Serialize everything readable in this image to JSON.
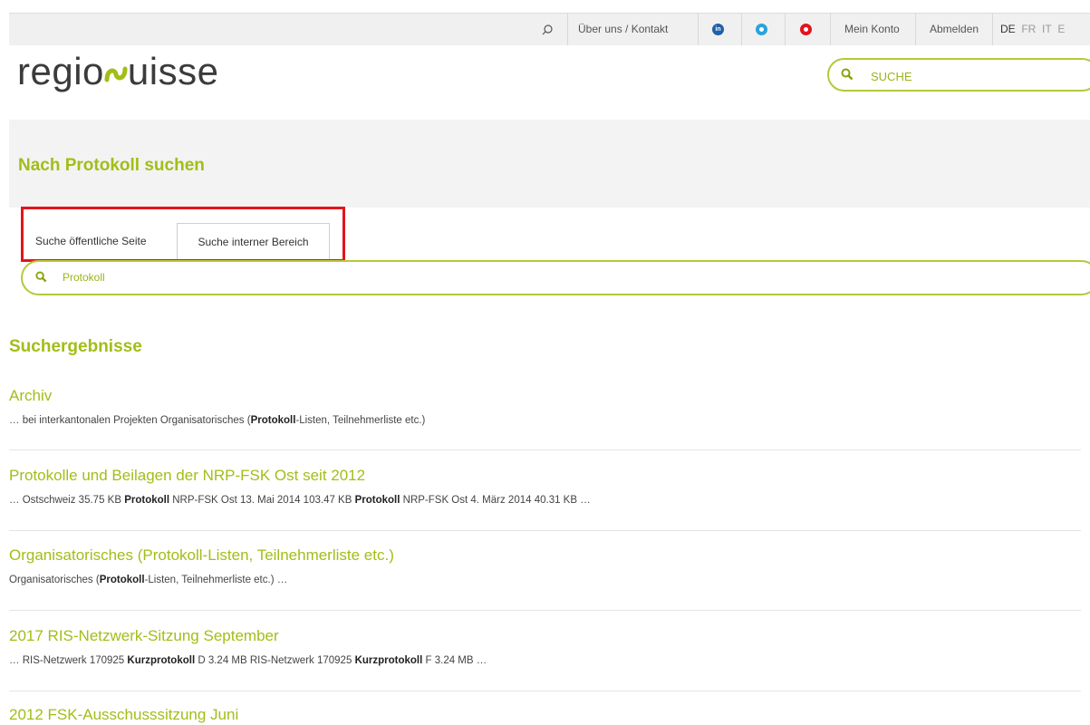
{
  "topbar": {
    "search_icon": "search-icon",
    "about": "Über uns / Kontakt",
    "social": [
      {
        "icon": "linkedin-icon",
        "glyph": "in",
        "color": "#1f5fa8"
      },
      {
        "icon": "twitter-icon",
        "glyph": "",
        "color": "#2aa3dd"
      },
      {
        "icon": "youtube-icon",
        "glyph": "",
        "color": "#e3141c"
      }
    ],
    "account": "Mein Konto",
    "logout": "Abmelden",
    "languages": [
      "DE",
      "FR",
      "IT",
      "E"
    ],
    "active_language": "DE"
  },
  "logo": {
    "part1": "regio",
    "mark": "ѕ",
    "part2": "uisse"
  },
  "header_search": {
    "placeholder": "SUCHE"
  },
  "page": {
    "title": "Nach Protokoll suchen"
  },
  "tabs": [
    {
      "label": "Suche öffentliche Seite",
      "active": false
    },
    {
      "label": "Suche interner Bereich",
      "active": true
    }
  ],
  "search": {
    "value": "Protokoll"
  },
  "results_heading": "Suchergebnisse",
  "results": [
    {
      "title": "Archiv",
      "snippet": [
        {
          "t": "… bei interkantonalen Projekten Organisatorisches (",
          "b": false
        },
        {
          "t": "Protokoll",
          "b": true
        },
        {
          "t": "-Listen, Teilnehmerliste etc.)",
          "b": false
        }
      ]
    },
    {
      "title": "Protokolle und Beilagen der NRP-FSK Ost seit 2012",
      "snippet": [
        {
          "t": "… Ostschweiz 35.75 KB ",
          "b": false
        },
        {
          "t": "Protokoll",
          "b": true
        },
        {
          "t": " NRP-FSK Ost 13. Mai 2014 103.47 KB ",
          "b": false
        },
        {
          "t": "Protokoll",
          "b": true
        },
        {
          "t": " NRP-FSK Ost 4. März 2014 40.31 KB …",
          "b": false
        }
      ]
    },
    {
      "title": "Organisatorisches (Protokoll-Listen, Teilnehmerliste etc.)",
      "snippet": [
        {
          "t": "Organisatorisches (",
          "b": false
        },
        {
          "t": "Protokoll",
          "b": true
        },
        {
          "t": "-Listen, Teilnehmerliste etc.) …",
          "b": false
        }
      ]
    },
    {
      "title": "2017 RIS-Netzwerk-Sitzung September",
      "snippet": [
        {
          "t": "… RIS-Netzwerk 170925 ",
          "b": false
        },
        {
          "t": "Kurzprotokoll",
          "b": true
        },
        {
          "t": " D 3.24 MB RIS-Netzwerk 170925 ",
          "b": false
        },
        {
          "t": "Kurzprotokoll",
          "b": true
        },
        {
          "t": " F 3.24 MB …",
          "b": false
        }
      ]
    },
    {
      "title": "2012 FSK-Ausschusssitzung Juni",
      "snippet": []
    }
  ],
  "colors": {
    "accent": "#a3bd17",
    "highlight": "#e3141c"
  }
}
